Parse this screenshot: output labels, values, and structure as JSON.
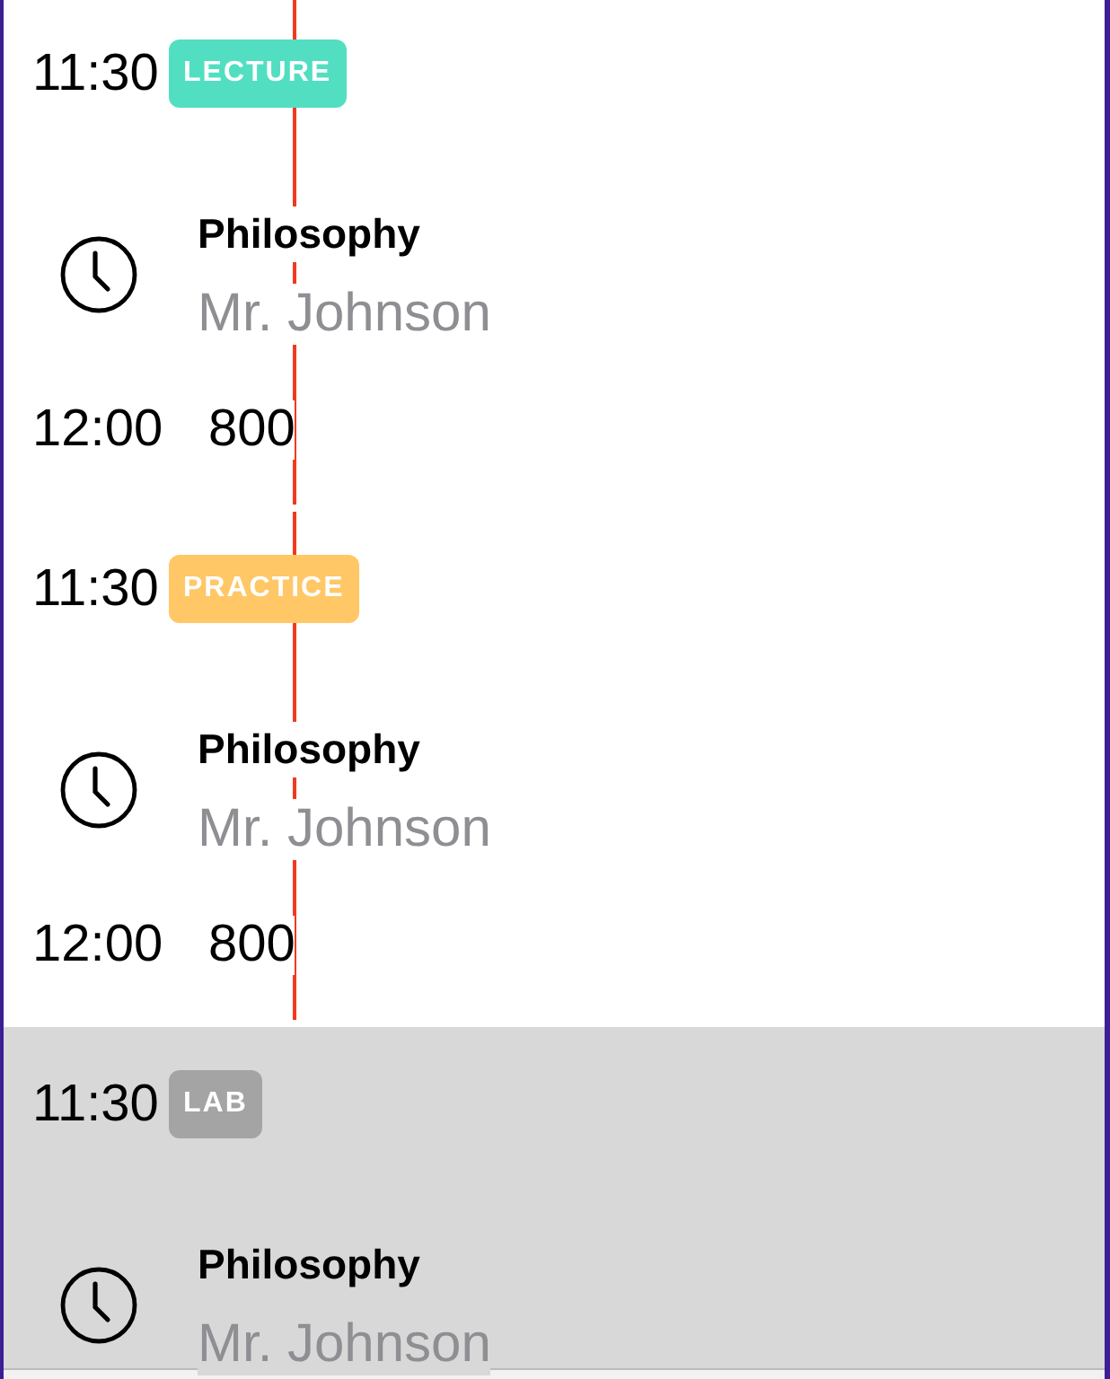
{
  "schedule": [
    {
      "start": "11:30",
      "tag": "LECTURE",
      "color": "#52dfc1",
      "title": "Philosophy",
      "teacher": "Mr. Johnson",
      "end": "12:00",
      "room": "800",
      "selected": false,
      "marker": true
    },
    {
      "start": "11:30",
      "tag": "PRACTICE",
      "color": "#ffc766",
      "title": "Philosophy",
      "teacher": "Mr. Johnson",
      "end": "12:00",
      "room": "800",
      "selected": false,
      "marker": true
    },
    {
      "start": "11:30",
      "tag": "LAB",
      "title": "Philosophy",
      "teacher": "Mr. Johnson",
      "selected": true,
      "marker": false
    }
  ]
}
